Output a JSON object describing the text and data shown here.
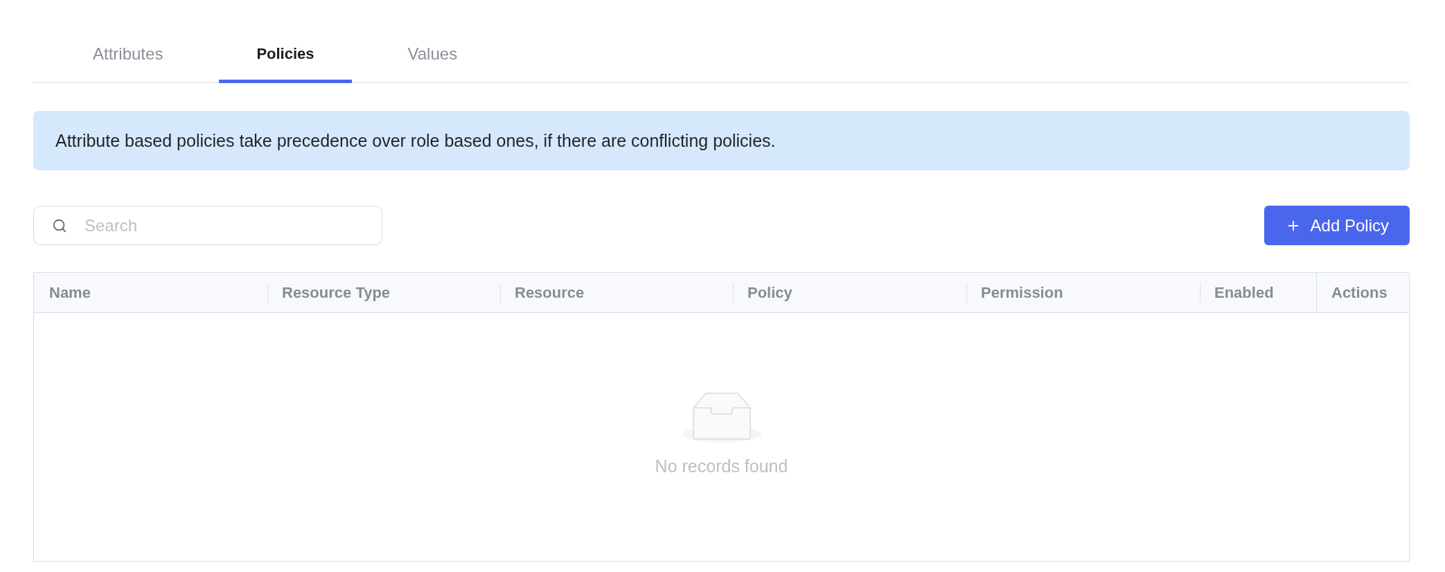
{
  "tabs": [
    {
      "label": "Attributes",
      "selected": false
    },
    {
      "label": "Policies",
      "selected": true
    },
    {
      "label": "Values",
      "selected": false
    }
  ],
  "notice": {
    "text": "Attribute based policies take precedence over role based ones, if there are conflicting policies."
  },
  "search": {
    "placeholder": "Search"
  },
  "add_button": {
    "label": "Add Policy"
  },
  "table": {
    "columns": [
      {
        "label": "Name",
        "kind": "normal"
      },
      {
        "label": "Resource Type",
        "kind": "normal"
      },
      {
        "label": "Resource",
        "kind": "normal"
      },
      {
        "label": "Policy",
        "kind": "normal"
      },
      {
        "label": "Permission",
        "kind": "normal"
      },
      {
        "label": "Enabled",
        "kind": "normal"
      },
      {
        "label": "Actions",
        "kind": "fixed"
      }
    ],
    "empty_message": "No records found"
  }
}
